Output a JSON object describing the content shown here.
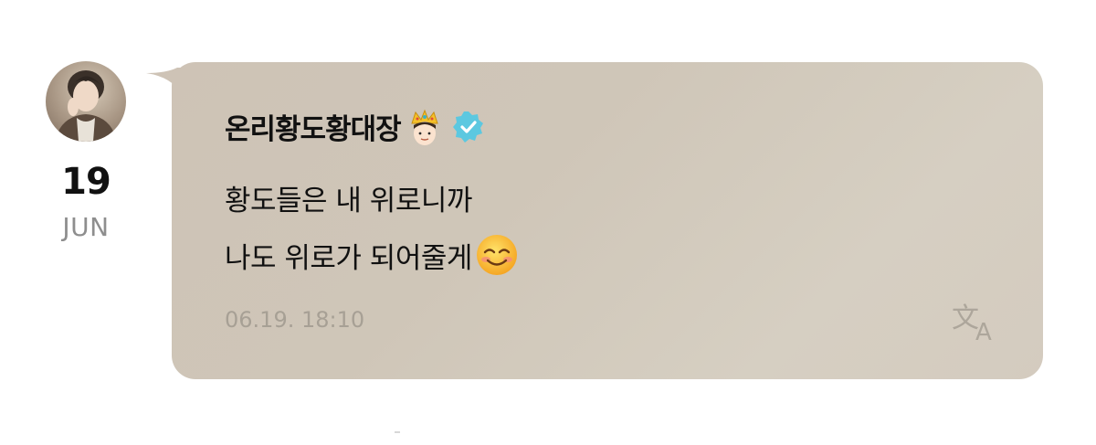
{
  "post": {
    "date_day": "19",
    "date_month": "JUN",
    "author_name": "온리황도황대장",
    "message_lines": [
      "황도들은 내 위로니까",
      "나도 위로가 되어줄게"
    ],
    "timestamp": "06.19. 18:10"
  },
  "icons": {
    "avatar": "profile-photo",
    "crown_emoji": "crown-face-emoji",
    "verified": "verified-badge-icon",
    "smile_emoji": "smiling-face-emoji",
    "translate": "translate-icon"
  },
  "colors": {
    "bubble": "#cfc6b8",
    "verified": "#5cc8e0",
    "timestamp": "#a7a095",
    "month": "#8e8e8e"
  }
}
